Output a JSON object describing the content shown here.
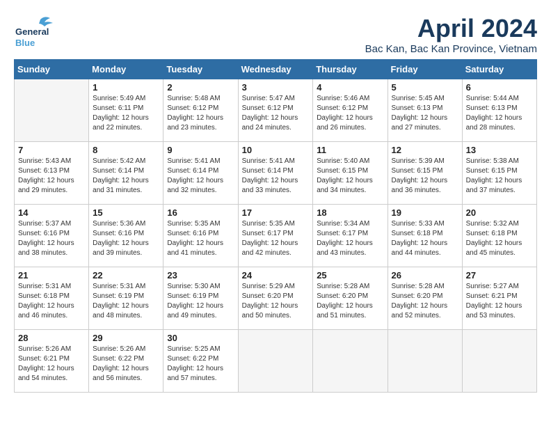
{
  "header": {
    "logo_line1": "General",
    "logo_line2": "Blue",
    "month": "April 2024",
    "location": "Bac Kan, Bac Kan Province, Vietnam"
  },
  "weekdays": [
    "Sunday",
    "Monday",
    "Tuesday",
    "Wednesday",
    "Thursday",
    "Friday",
    "Saturday"
  ],
  "weeks": [
    [
      {
        "day": "",
        "info": ""
      },
      {
        "day": "1",
        "info": "Sunrise: 5:49 AM\nSunset: 6:11 PM\nDaylight: 12 hours\nand 22 minutes."
      },
      {
        "day": "2",
        "info": "Sunrise: 5:48 AM\nSunset: 6:12 PM\nDaylight: 12 hours\nand 23 minutes."
      },
      {
        "day": "3",
        "info": "Sunrise: 5:47 AM\nSunset: 6:12 PM\nDaylight: 12 hours\nand 24 minutes."
      },
      {
        "day": "4",
        "info": "Sunrise: 5:46 AM\nSunset: 6:12 PM\nDaylight: 12 hours\nand 26 minutes."
      },
      {
        "day": "5",
        "info": "Sunrise: 5:45 AM\nSunset: 6:13 PM\nDaylight: 12 hours\nand 27 minutes."
      },
      {
        "day": "6",
        "info": "Sunrise: 5:44 AM\nSunset: 6:13 PM\nDaylight: 12 hours\nand 28 minutes."
      }
    ],
    [
      {
        "day": "7",
        "info": "Sunrise: 5:43 AM\nSunset: 6:13 PM\nDaylight: 12 hours\nand 29 minutes."
      },
      {
        "day": "8",
        "info": "Sunrise: 5:42 AM\nSunset: 6:14 PM\nDaylight: 12 hours\nand 31 minutes."
      },
      {
        "day": "9",
        "info": "Sunrise: 5:41 AM\nSunset: 6:14 PM\nDaylight: 12 hours\nand 32 minutes."
      },
      {
        "day": "10",
        "info": "Sunrise: 5:41 AM\nSunset: 6:14 PM\nDaylight: 12 hours\nand 33 minutes."
      },
      {
        "day": "11",
        "info": "Sunrise: 5:40 AM\nSunset: 6:15 PM\nDaylight: 12 hours\nand 34 minutes."
      },
      {
        "day": "12",
        "info": "Sunrise: 5:39 AM\nSunset: 6:15 PM\nDaylight: 12 hours\nand 36 minutes."
      },
      {
        "day": "13",
        "info": "Sunrise: 5:38 AM\nSunset: 6:15 PM\nDaylight: 12 hours\nand 37 minutes."
      }
    ],
    [
      {
        "day": "14",
        "info": "Sunrise: 5:37 AM\nSunset: 6:16 PM\nDaylight: 12 hours\nand 38 minutes."
      },
      {
        "day": "15",
        "info": "Sunrise: 5:36 AM\nSunset: 6:16 PM\nDaylight: 12 hours\nand 39 minutes."
      },
      {
        "day": "16",
        "info": "Sunrise: 5:35 AM\nSunset: 6:16 PM\nDaylight: 12 hours\nand 41 minutes."
      },
      {
        "day": "17",
        "info": "Sunrise: 5:35 AM\nSunset: 6:17 PM\nDaylight: 12 hours\nand 42 minutes."
      },
      {
        "day": "18",
        "info": "Sunrise: 5:34 AM\nSunset: 6:17 PM\nDaylight: 12 hours\nand 43 minutes."
      },
      {
        "day": "19",
        "info": "Sunrise: 5:33 AM\nSunset: 6:18 PM\nDaylight: 12 hours\nand 44 minutes."
      },
      {
        "day": "20",
        "info": "Sunrise: 5:32 AM\nSunset: 6:18 PM\nDaylight: 12 hours\nand 45 minutes."
      }
    ],
    [
      {
        "day": "21",
        "info": "Sunrise: 5:31 AM\nSunset: 6:18 PM\nDaylight: 12 hours\nand 46 minutes."
      },
      {
        "day": "22",
        "info": "Sunrise: 5:31 AM\nSunset: 6:19 PM\nDaylight: 12 hours\nand 48 minutes."
      },
      {
        "day": "23",
        "info": "Sunrise: 5:30 AM\nSunset: 6:19 PM\nDaylight: 12 hours\nand 49 minutes."
      },
      {
        "day": "24",
        "info": "Sunrise: 5:29 AM\nSunset: 6:20 PM\nDaylight: 12 hours\nand 50 minutes."
      },
      {
        "day": "25",
        "info": "Sunrise: 5:28 AM\nSunset: 6:20 PM\nDaylight: 12 hours\nand 51 minutes."
      },
      {
        "day": "26",
        "info": "Sunrise: 5:28 AM\nSunset: 6:20 PM\nDaylight: 12 hours\nand 52 minutes."
      },
      {
        "day": "27",
        "info": "Sunrise: 5:27 AM\nSunset: 6:21 PM\nDaylight: 12 hours\nand 53 minutes."
      }
    ],
    [
      {
        "day": "28",
        "info": "Sunrise: 5:26 AM\nSunset: 6:21 PM\nDaylight: 12 hours\nand 54 minutes."
      },
      {
        "day": "29",
        "info": "Sunrise: 5:26 AM\nSunset: 6:22 PM\nDaylight: 12 hours\nand 56 minutes."
      },
      {
        "day": "30",
        "info": "Sunrise: 5:25 AM\nSunset: 6:22 PM\nDaylight: 12 hours\nand 57 minutes."
      },
      {
        "day": "",
        "info": ""
      },
      {
        "day": "",
        "info": ""
      },
      {
        "day": "",
        "info": ""
      },
      {
        "day": "",
        "info": ""
      }
    ]
  ]
}
